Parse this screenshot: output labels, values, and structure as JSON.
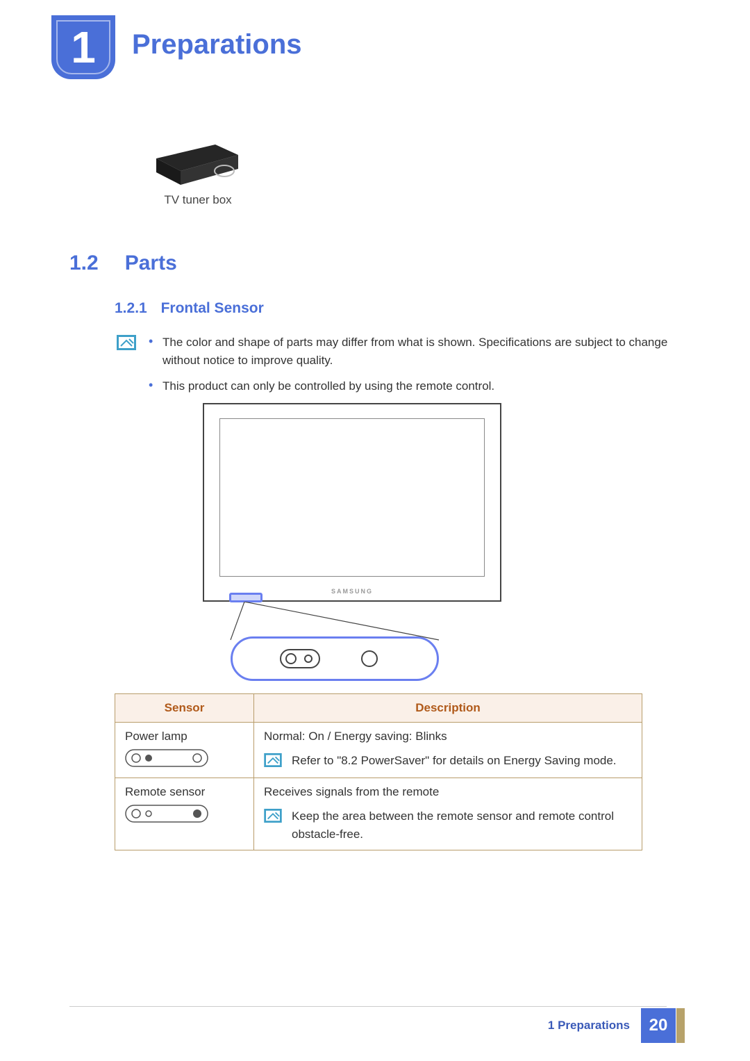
{
  "header": {
    "chapter_number": "1",
    "chapter_title": "Preparations"
  },
  "tuner": {
    "caption": "TV tuner box"
  },
  "section": {
    "number": "1.2",
    "title": "Parts"
  },
  "subsection": {
    "number": "1.2.1",
    "title": "Frontal Sensor"
  },
  "notes": {
    "bullets": [
      "The color and shape of parts may differ from what is shown. Specifications are subject to change without notice to improve quality.",
      "This product can only be controlled by using the remote control."
    ]
  },
  "monitor": {
    "brand": "SAMSUNG"
  },
  "table": {
    "headers": {
      "sensor": "Sensor",
      "description": "Description"
    },
    "rows": [
      {
        "sensor": "Power lamp",
        "desc": "Normal: On / Energy saving: Blinks",
        "note": "Refer to \"8.2 PowerSaver\" for details on Energy Saving mode."
      },
      {
        "sensor": "Remote sensor",
        "desc": "Receives signals from the remote",
        "note": "Keep the area between the remote sensor and remote control obstacle-free."
      }
    ]
  },
  "footer": {
    "label": "1 Preparations",
    "page": "20"
  }
}
